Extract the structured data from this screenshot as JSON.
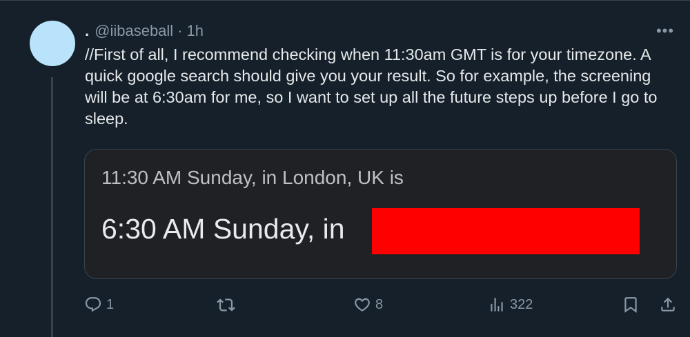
{
  "tweet": {
    "display_name": ".",
    "handle": "@iibaseball",
    "separator": "·",
    "time": "1h",
    "more_label": "•••",
    "text": "//First of all, I recommend checking when 11:30am GMT is for your timezone. A quick google search should give you your result. So for example, the screening will be at 6:30am for me, so I want to set up all the future steps up before I go to sleep."
  },
  "media": {
    "line1": "11:30 AM Sunday, in London, UK is",
    "line2": "6:30 AM Sunday, in",
    "redaction_color": "#ff0000"
  },
  "actions": {
    "reply_count": "1",
    "retweet_count": "",
    "like_count": "8",
    "views_count": "322"
  },
  "colors": {
    "background": "#15202b",
    "avatar": "#b9e3fb",
    "text_primary": "#e7e9ea",
    "text_secondary": "#8b98a5",
    "media_background": "#202124"
  }
}
